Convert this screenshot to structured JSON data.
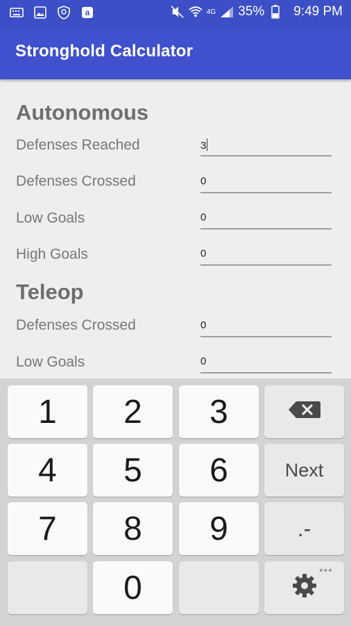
{
  "status": {
    "battery": "35%",
    "time": "9:49 PM",
    "network": "4G"
  },
  "app": {
    "title": "Stronghold Calculator"
  },
  "autonomous": {
    "title": "Autonomous",
    "fields": [
      {
        "label": "Defenses Reached",
        "value": "3"
      },
      {
        "label": "Defenses Crossed",
        "value": "0"
      },
      {
        "label": "Low Goals",
        "value": "0"
      },
      {
        "label": "High Goals",
        "value": "0"
      }
    ]
  },
  "teleop": {
    "title": "Teleop",
    "fields": [
      {
        "label": "Defenses Crossed",
        "value": "0"
      },
      {
        "label": "Low Goals",
        "value": "0"
      }
    ]
  },
  "keyboard": {
    "keys": [
      "1",
      "2",
      "3",
      "4",
      "5",
      "6",
      "7",
      "8",
      "9",
      "0"
    ],
    "next_label": "Next",
    "symbols_label": ".-",
    "icons": [
      "backspace-icon",
      "settings-gear-icon"
    ]
  }
}
